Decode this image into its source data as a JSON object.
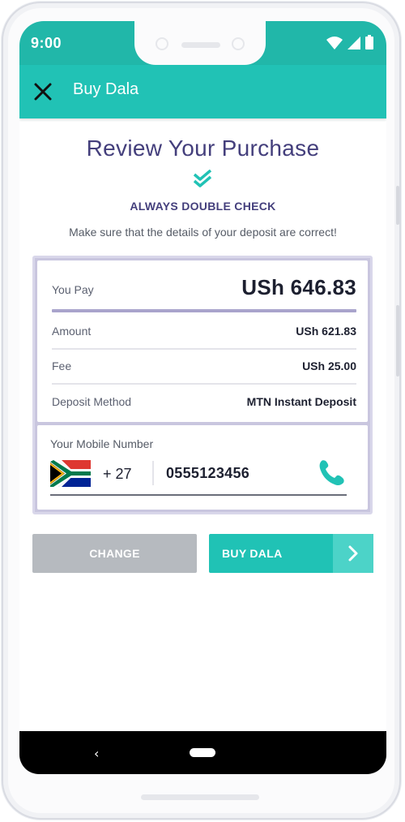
{
  "status_bar": {
    "time": "9:00",
    "icons": [
      "wifi-icon",
      "cell-signal-icon",
      "battery-icon"
    ]
  },
  "app_bar": {
    "title": "Buy Dala",
    "close_icon": "close-icon"
  },
  "review": {
    "title": "Review Your Purchase",
    "check_icon": "double-check-icon",
    "subtitle": "ALWAYS DOUBLE CHECK",
    "note": "Make sure that the details of your deposit are correct!"
  },
  "summary": {
    "you_pay_label": "You Pay",
    "you_pay_value": "USh 646.83",
    "rows": [
      {
        "label": "Amount",
        "value": "USh 621.83"
      },
      {
        "label": "Fee",
        "value": "USh 25.00"
      },
      {
        "label": "Deposit Method",
        "value": "MTN Instant Deposit"
      }
    ]
  },
  "mobile": {
    "label": "Your Mobile Number",
    "flag_icon": "south-africa-flag-icon",
    "country_code": "+ 27",
    "number": "0555123456",
    "call_icon": "phone-icon"
  },
  "actions": {
    "change_label": "CHANGE",
    "buy_label": "BUY DALA",
    "arrow_icon": "chevron-right-icon"
  },
  "nav_bar": {
    "back_glyph": "‹"
  },
  "colors": {
    "primary": "#21c2b5",
    "status_bar": "#21b7a9",
    "heading": "#443f7c",
    "accent_line": "#a9a4cc",
    "disabled_button": "#b6babf",
    "arrow_box": "#4cd3c8"
  }
}
